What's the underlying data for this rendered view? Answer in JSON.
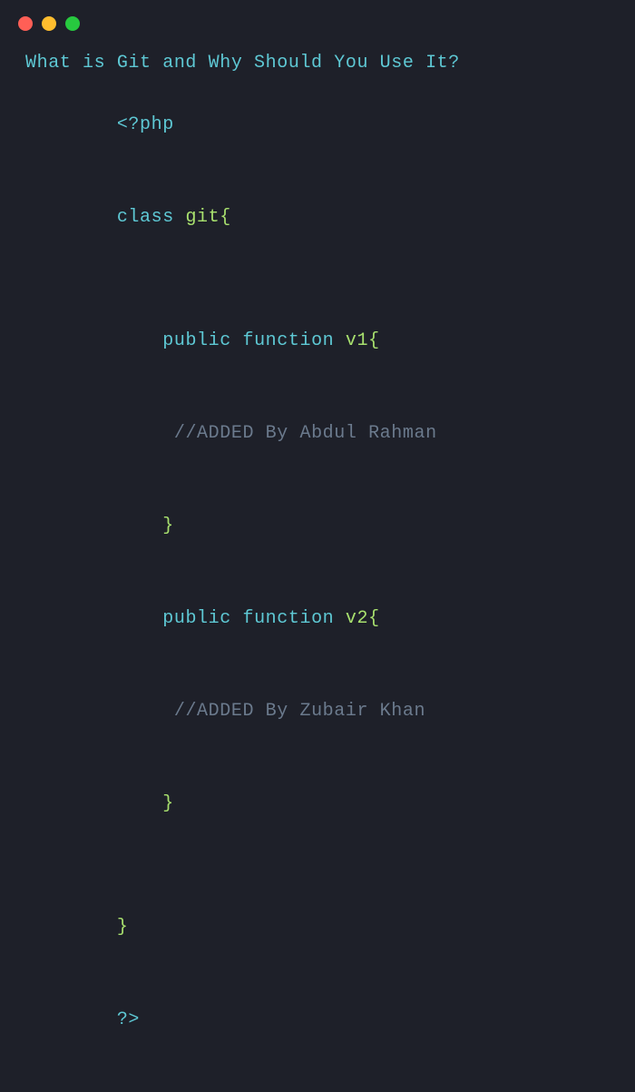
{
  "window": {
    "background": "#1e2029"
  },
  "traffic_lights": {
    "red": "#ff5f56",
    "yellow": "#ffbd2e",
    "green": "#27c93f"
  },
  "title_line": "What is Git and Why Should You Use It?",
  "code": {
    "line1": "<?php",
    "line2_kw": "class ",
    "line2_name": "git",
    "line2_brace": "{",
    "line3": "",
    "fn1_indent": "    ",
    "fn1_pub": "public ",
    "fn1_func": "function ",
    "fn1_name": "v1",
    "fn1_brace": "{",
    "fn1_comment_indent": "     ",
    "fn1_comment": "//ADDED By Abdul Rahman",
    "fn1_close_indent": "    ",
    "fn1_close": "}",
    "fn2_indent": "    ",
    "fn2_pub": "public ",
    "fn2_func": "function ",
    "fn2_name": "v2",
    "fn2_brace": "{",
    "fn2_comment_indent": "     ",
    "fn2_comment": "//ADDED By Zubair Khan",
    "fn2_close_indent": "    ",
    "fn2_close": "}",
    "line_empty": "",
    "close_brace": "}",
    "close_php": "?>"
  }
}
